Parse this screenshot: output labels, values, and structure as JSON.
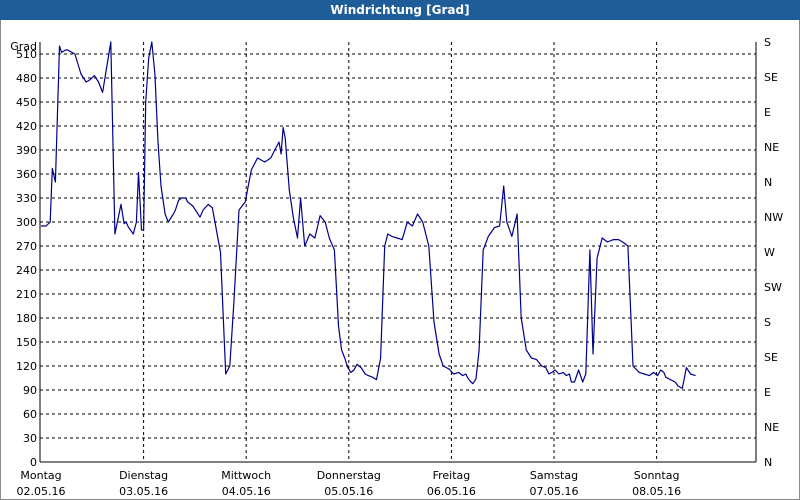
{
  "window": {
    "title": "Windrichtung [Grad]"
  },
  "chart_data": {
    "type": "line",
    "title": "Windrichtung [Grad]",
    "ylabel": "Grad",
    "ylim": [
      0,
      525
    ],
    "yticks": [
      0,
      30,
      60,
      90,
      120,
      150,
      180,
      210,
      240,
      270,
      300,
      330,
      360,
      390,
      420,
      450,
      480,
      510
    ],
    "right_axis_labels": [
      "S",
      "SE",
      "E",
      "NE",
      "N",
      "NW",
      "W",
      "SW",
      "S",
      "SE",
      "E",
      "NE",
      "N"
    ],
    "x_day_labels": [
      {
        "day": "Montag",
        "date": "02.05.16"
      },
      {
        "day": "Dienstag",
        "date": "03.05.16"
      },
      {
        "day": "Mittwoch",
        "date": "04.05.16"
      },
      {
        "day": "Donnerstag",
        "date": "05.05.16"
      },
      {
        "day": "Freitag",
        "date": "06.05.16"
      },
      {
        "day": "Samstag",
        "date": "07.05.16"
      },
      {
        "day": "Sonntag",
        "date": "08.05.16"
      }
    ],
    "xlim_days": [
      0,
      7
    ],
    "grid": true,
    "line_color": "#00008b",
    "series": [
      {
        "x_days": [
          0.0,
          0.05,
          0.09,
          0.11,
          0.14,
          0.18,
          0.2,
          0.24,
          0.26,
          0.33,
          0.39,
          0.44,
          0.48,
          0.52,
          0.56,
          0.6,
          0.68,
          0.72,
          0.78,
          0.81,
          0.83,
          0.85,
          0.9,
          0.93,
          0.95,
          0.98,
          1.0,
          1.02,
          1.05,
          1.08,
          1.11,
          1.14,
          1.17,
          1.21,
          1.24,
          1.29,
          1.31,
          1.34,
          1.37,
          1.41,
          1.43,
          1.46,
          1.48,
          1.52,
          1.55,
          1.58,
          1.63,
          1.67,
          1.71,
          1.75,
          1.8,
          1.84,
          1.88,
          1.93,
          1.99,
          2.05,
          2.11,
          2.18,
          2.24,
          2.29,
          2.32,
          2.34,
          2.36,
          2.38,
          2.42,
          2.46,
          2.5,
          2.53,
          2.57,
          2.62,
          2.67,
          2.72,
          2.77,
          2.81,
          2.86,
          2.9,
          2.93,
          2.96,
          2.99,
          3.02,
          3.05,
          3.08,
          3.12,
          3.16,
          3.19,
          3.23,
          3.27,
          3.31,
          3.35,
          3.38,
          3.42,
          3.47,
          3.52,
          3.57,
          3.62,
          3.67,
          3.72,
          3.78,
          3.83,
          3.88,
          3.92,
          3.95,
          3.98,
          4.02,
          4.07,
          4.11,
          4.14,
          4.16,
          4.19,
          4.21,
          4.24,
          4.27,
          4.31,
          4.36,
          4.42,
          4.47,
          4.51,
          4.54,
          4.59,
          4.64,
          4.68,
          4.73,
          4.78,
          4.83,
          4.88,
          4.92,
          4.95,
          4.98,
          5.01,
          5.05,
          5.09,
          5.12,
          5.15,
          5.17,
          5.2,
          5.24,
          5.28,
          5.31,
          5.35,
          5.38,
          5.42,
          5.47,
          5.52,
          5.58,
          5.63,
          5.67,
          5.72,
          5.77,
          5.83,
          5.88,
          5.93,
          5.97,
          6.01,
          6.04,
          6.07,
          6.09,
          6.12,
          6.15,
          6.18,
          6.21,
          6.25,
          6.29,
          6.33,
          6.38,
          6.43,
          6.48,
          6.53,
          6.58,
          6.63,
          6.68,
          6.73,
          6.78,
          6.83,
          6.88,
          6.93,
          6.97
        ],
        "y": [
          295,
          295,
          300,
          367,
          350,
          520,
          512,
          515,
          515,
          510,
          485,
          475,
          478,
          483,
          475,
          462,
          525,
          285,
          322,
          298,
          300,
          294,
          285,
          300,
          362,
          290,
          290,
          450,
          505,
          525,
          485,
          400,
          345,
          310,
          300,
          310,
          315,
          327,
          330,
          330,
          325,
          322,
          320,
          312,
          306,
          315,
          322,
          318,
          290,
          262,
          110,
          120,
          200,
          315,
          325,
          365,
          380,
          375,
          380,
          393,
          400,
          385,
          418,
          405,
          340,
          305,
          280,
          330,
          270,
          285,
          280,
          308,
          300,
          280,
          265,
          170,
          140,
          130,
          118,
          112,
          115,
          122,
          118,
          110,
          108,
          106,
          103,
          130,
          270,
          285,
          282,
          280,
          278,
          300,
          295,
          310,
          300,
          270,
          175,
          135,
          120,
          118,
          116,
          110,
          112,
          108,
          110,
          105,
          100,
          98,
          104,
          140,
          265,
          282,
          293,
          295,
          345,
          300,
          282,
          310,
          180,
          140,
          130,
          128,
          120,
          118,
          110,
          112,
          115,
          110,
          112,
          108,
          110,
          100,
          100,
          115,
          100,
          110,
          265,
          135,
          255,
          280,
          275,
          278,
          278,
          275,
          270,
          120,
          112,
          110,
          108,
          112,
          108,
          115,
          112,
          106,
          104,
          102,
          100,
          95,
          92,
          118,
          110,
          108
        ]
      }
    ]
  }
}
